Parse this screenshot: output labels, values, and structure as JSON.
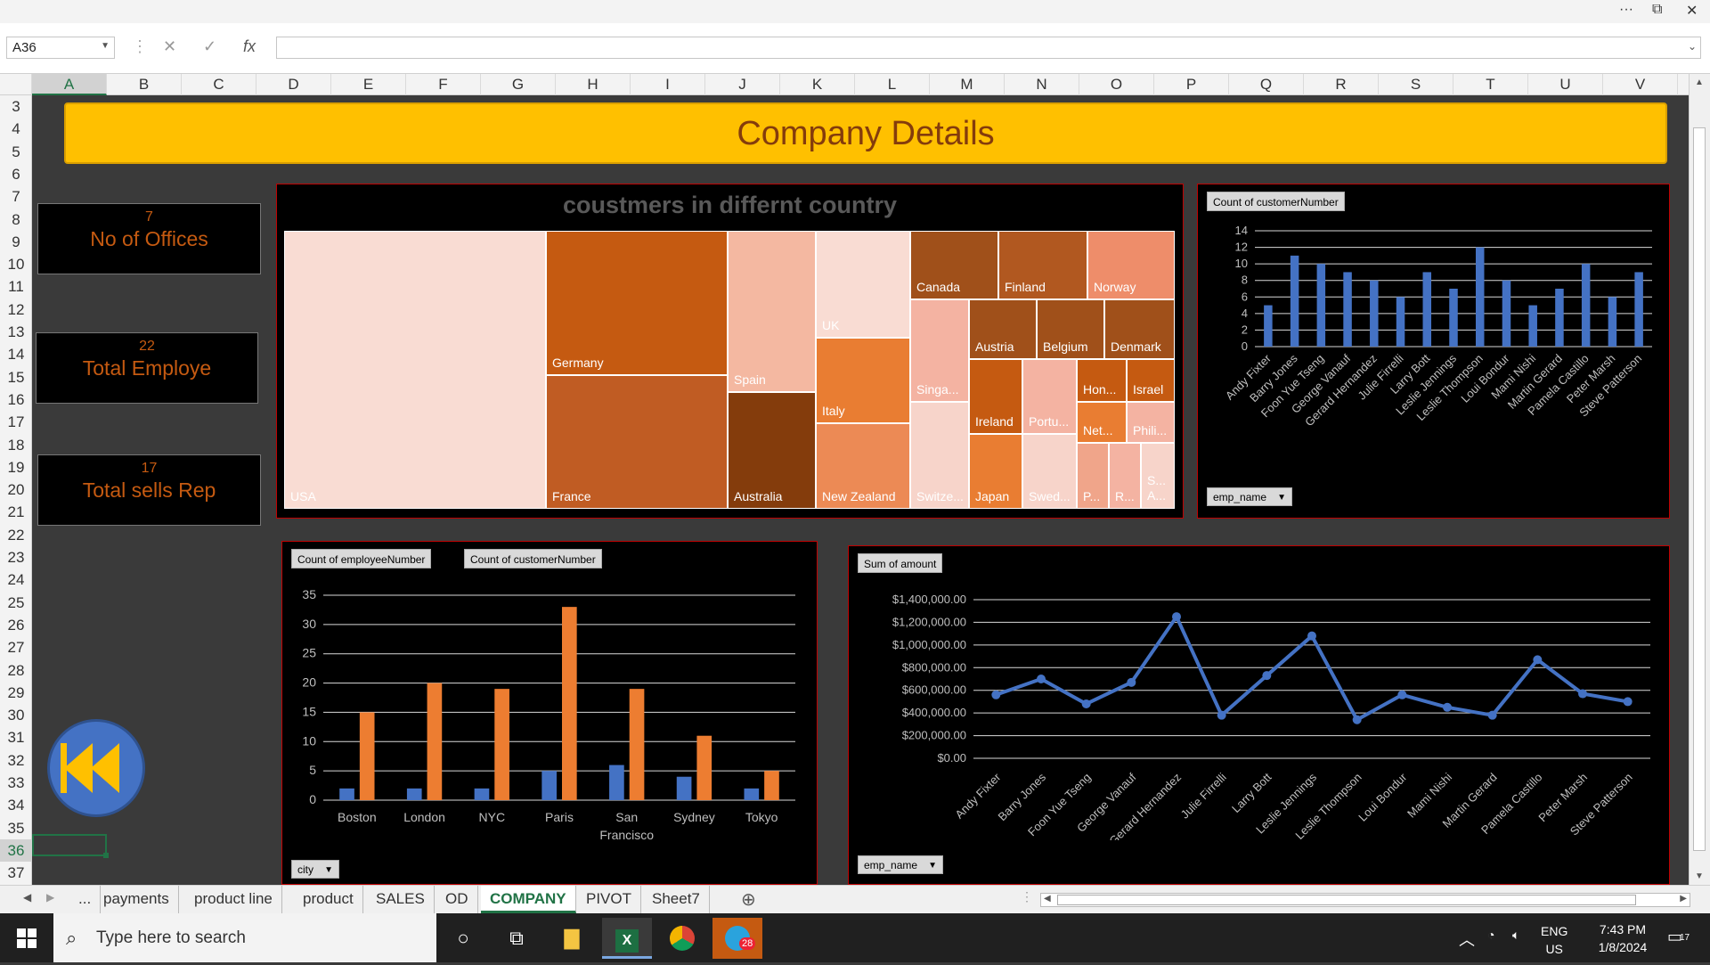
{
  "window": {
    "title_controls": [
      "more-icon",
      "restore-icon",
      "close-icon"
    ]
  },
  "formula_bar": {
    "name_box": "A36",
    "formula": "",
    "fx_label": "fx"
  },
  "columns": [
    "A",
    "B",
    "C",
    "D",
    "E",
    "F",
    "G",
    "H",
    "I",
    "J",
    "K",
    "L",
    "M",
    "N",
    "O",
    "P",
    "Q",
    "R",
    "S",
    "T",
    "U",
    "V"
  ],
  "rows": [
    "3",
    "4",
    "5",
    "6",
    "7",
    "8",
    "9",
    "10",
    "11",
    "12",
    "13",
    "14",
    "15",
    "16",
    "17",
    "18",
    "19",
    "20",
    "21",
    "22",
    "23",
    "24",
    "25",
    "26",
    "27",
    "28",
    "29",
    "30",
    "31",
    "32",
    "33",
    "34",
    "35",
    "36",
    "37"
  ],
  "banner": {
    "title": "Company Details"
  },
  "kpis": [
    {
      "value": "7",
      "label": "No of Offices"
    },
    {
      "value": "22",
      "label": "Total Employe"
    },
    {
      "value": "17",
      "label": "Total sells Rep"
    }
  ],
  "treemap": {
    "title": "coustmers in differnt country",
    "cells": [
      "USA",
      "Germany",
      "France",
      "Spain",
      "Australia",
      "UK",
      "Italy",
      "New Zealand",
      "Canada",
      "Finland",
      "Norway",
      "Singa...",
      "Switze...",
      "Austria",
      "Belgium",
      "Denmark",
      "Ireland",
      "Portu...",
      "Japan",
      "Swed...",
      "Hon...",
      "Israel",
      "Net...",
      "Phili...",
      "P...",
      "R...",
      "S... A..."
    ]
  },
  "colors": {
    "banner": "#ffc000",
    "kpi_text": "#c55a11",
    "blue": "#4472c4",
    "orange": "#ed7d31",
    "panel_border": "#c00000"
  },
  "chart_data": [
    {
      "type": "bar",
      "title": "",
      "field_button": "Count of customerNumber",
      "filter_button": "emp_name",
      "categories": [
        "Andy Fixter",
        "Barry Jones",
        "Foon Yue Tseng",
        "George Vanauf",
        "Gerard Hernandez",
        "Julie Firrelli",
        "Larry Bott",
        "Leslie Jennings",
        "Leslie Thompson",
        "Loui Bondur",
        "Mami Nishi",
        "Martin Gerard",
        "Pamela Castillo",
        "Peter Marsh",
        "Steve Patterson"
      ],
      "series": [
        {
          "values": [
            5,
            11,
            10,
            9,
            8,
            6,
            9,
            7,
            12,
            8,
            5,
            7,
            10,
            6,
            9
          ]
        }
      ],
      "ylim": [
        0,
        14
      ],
      "yticks": [
        "0",
        "2",
        "4",
        "6",
        "8",
        "10",
        "12",
        "14"
      ],
      "grid": true
    },
    {
      "type": "bar",
      "title": "",
      "field_buttons": [
        "Count of employeeNumber",
        "Count of customerNumber"
      ],
      "filter_button": "city",
      "categories": [
        "Boston",
        "London",
        "NYC",
        "Paris",
        "San Francisco",
        "Sydney",
        "Tokyo"
      ],
      "series": [
        {
          "name": "Count of employeeNumber",
          "values": [
            2,
            2,
            2,
            5,
            6,
            4,
            2
          ]
        },
        {
          "name": "Count of customerNumber",
          "values": [
            15,
            20,
            19,
            33,
            19,
            11,
            5
          ]
        }
      ],
      "ylim": [
        0,
        35
      ],
      "yticks": [
        "0",
        "5",
        "10",
        "15",
        "20",
        "25",
        "30",
        "35"
      ],
      "grid": true
    },
    {
      "type": "line",
      "title": "",
      "field_button": "Sum of amount",
      "filter_button": "emp_name",
      "categories": [
        "Andy Fixter",
        "Barry Jones",
        "Foon Yue Tseng",
        "George Vanauf",
        "Gerard Hernandez",
        "Julie Firrelli",
        "Larry Bott",
        "Leslie Jennings",
        "Leslie Thompson",
        "Loui Bondur",
        "Mami Nishi",
        "Martin Gerard",
        "Pamela Castillo",
        "Peter Marsh",
        "Steve Patterson"
      ],
      "series": [
        {
          "values": [
            560000,
            700000,
            480000,
            670000,
            1250000,
            380000,
            730000,
            1080000,
            340000,
            560000,
            450000,
            380000,
            870000,
            570000,
            500000
          ]
        }
      ],
      "ylim": [
        0,
        1400000
      ],
      "yticks": [
        "$0.00",
        "$200,000.00",
        "$400,000.00",
        "$600,000.00",
        "$800,000.00",
        "$1,000,000.00",
        "$1,200,000.00",
        "$1,400,000.00"
      ],
      "grid": true
    }
  ],
  "sheet_tabs": [
    "...",
    "payments",
    "product line",
    "product",
    "SALES",
    "OD",
    "COMPANY",
    "PIVOT",
    "Sheet7"
  ],
  "active_tab": "COMPANY",
  "taskbar": {
    "search_placeholder": "Type here to search",
    "lang": "ENG",
    "region": "US",
    "time": "7:43 PM",
    "date": "1/8/2024",
    "notification_count": "17",
    "telegram_badge": "28"
  }
}
